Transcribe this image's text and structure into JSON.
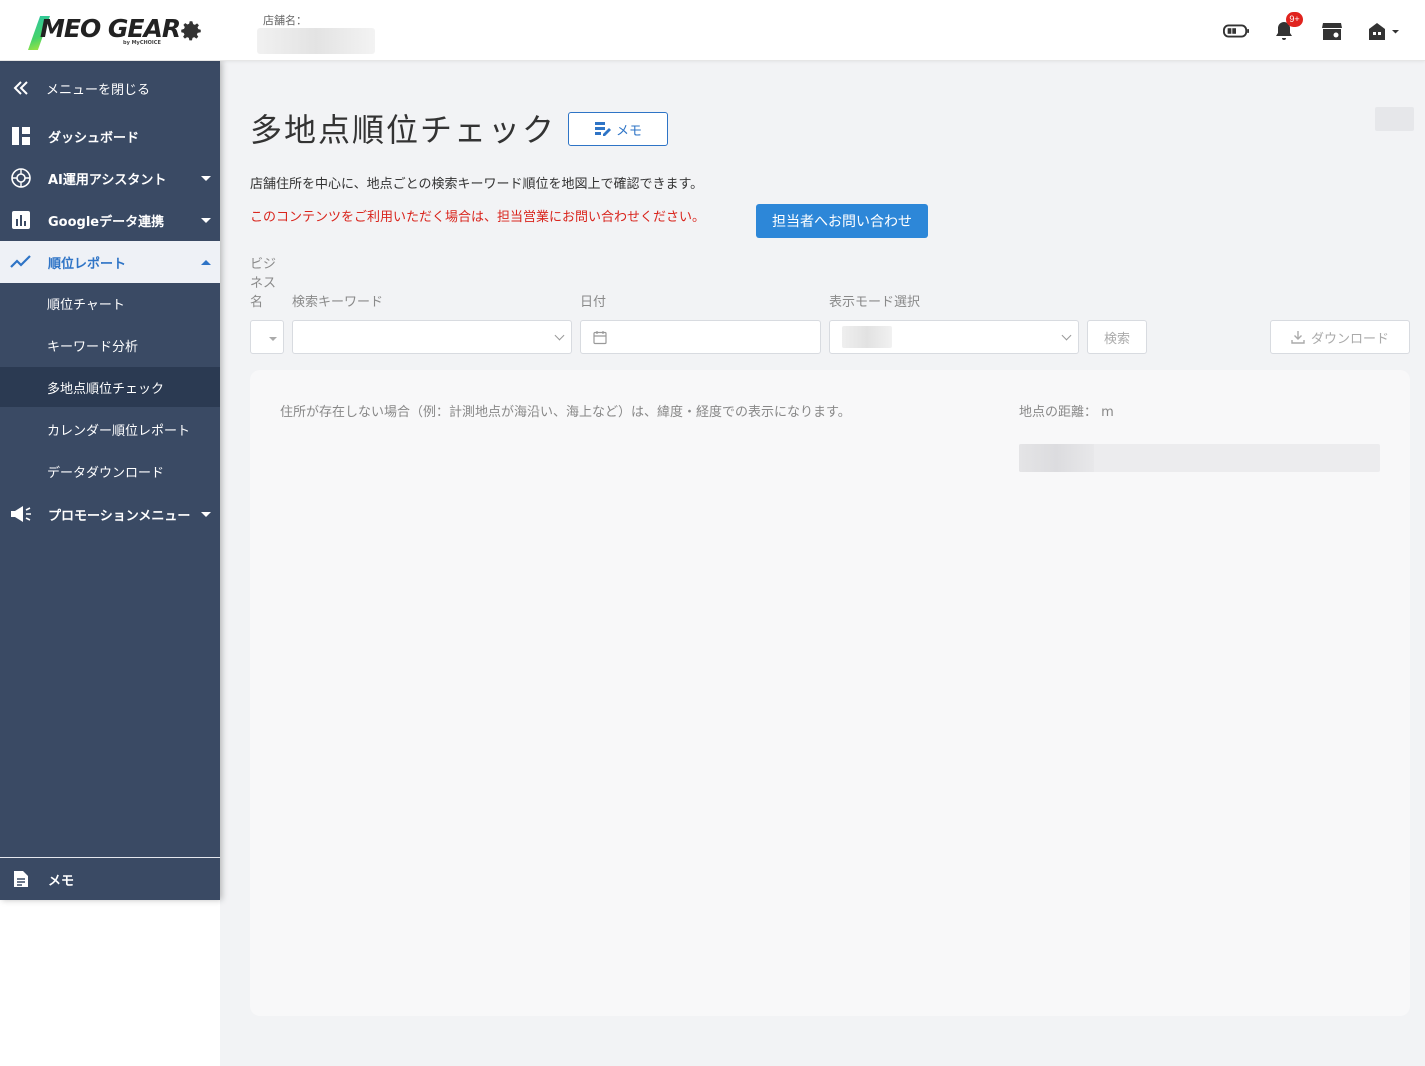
{
  "header": {
    "logo_text": "MEO GEAR",
    "logo_sub": "by MyCHOICE",
    "shop_label": "店舗名：",
    "notification_badge": "9+"
  },
  "sidebar": {
    "close_label": "メニューを閉じる",
    "items": [
      {
        "label": "ダッシュボード",
        "icon": "dashboard-icon"
      },
      {
        "label": "AI運用アシスタント",
        "icon": "ai-icon"
      },
      {
        "label": "Googleデータ連携",
        "icon": "bar-chart-icon"
      },
      {
        "label": "順位レポート",
        "icon": "trend-icon"
      },
      {
        "label": "プロモーションメニュー",
        "icon": "megaphone-icon"
      }
    ],
    "sub_items": [
      {
        "label": "順位チャート"
      },
      {
        "label": "キーワード分析"
      },
      {
        "label": "多地点順位チェック"
      },
      {
        "label": "カレンダー順位レポート"
      },
      {
        "label": "データダウンロード"
      }
    ],
    "memo_label": "メモ"
  },
  "main": {
    "title": "多地点順位チェック",
    "memo_button": "メモ",
    "description": "店舗住所を中心に、地点ごとの検索キーワード順位を地図上で確認できます。",
    "warning": "このコンテンツをご利用いただく場合は、担当営業にお問い合わせください。",
    "contact_button": "担当者へお問い合わせ",
    "filters": {
      "business_label_1": "ビジ",
      "business_label_2": "ネス",
      "business_label_3": "名",
      "keyword_label": "検索キーワード",
      "date_label": "日付",
      "mode_label": "表示モード選択",
      "search_button": "検索",
      "download_button": "ダウンロード"
    },
    "panel": {
      "note": "住所が存在しない場合（例：計測地点が海沿い、海上など）は、緯度・経度での表示になります。",
      "distance_label": "地点の距離： m"
    }
  },
  "colors": {
    "sidebar_bg": "#3a4a64",
    "accent": "#2e74c6",
    "warning": "#d9251d",
    "primary_button": "#2d87d8"
  }
}
